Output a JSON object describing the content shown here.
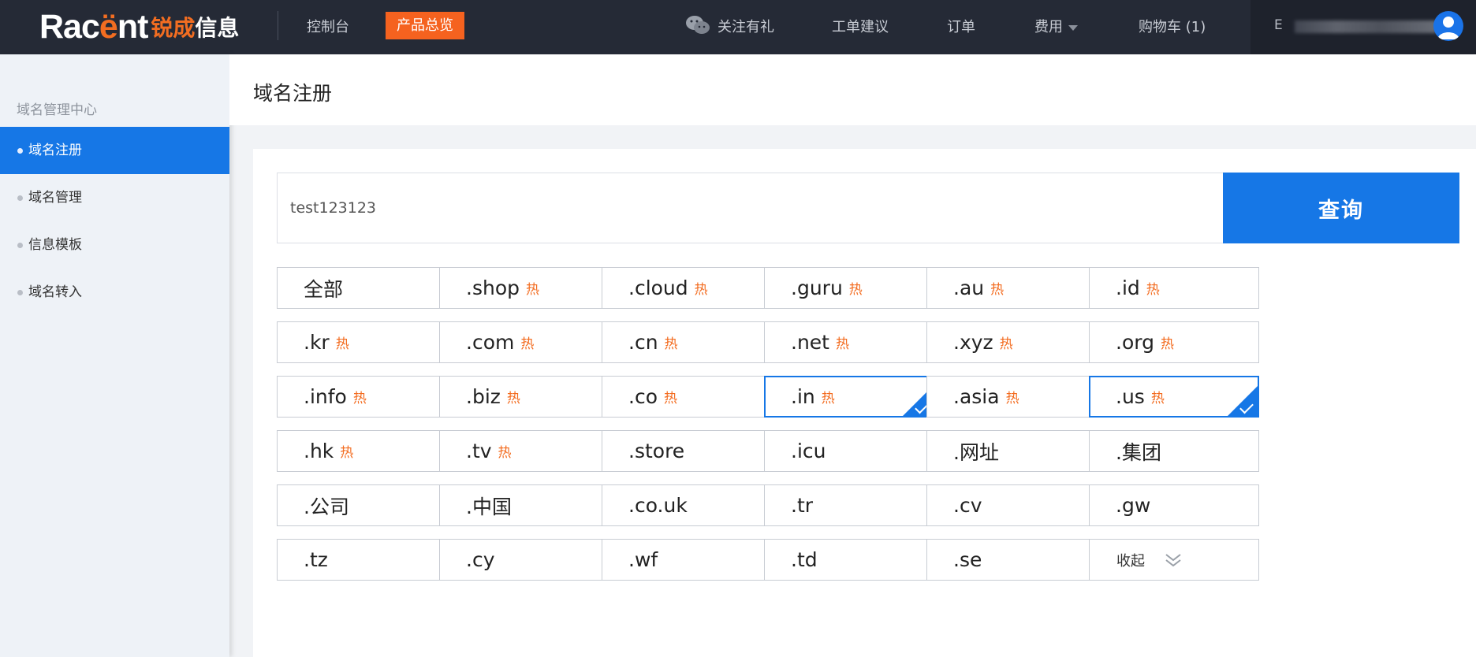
{
  "topbar": {
    "logo": {
      "main_a": "Rac",
      "main_accent": "ë",
      "main_b": "nt",
      "sub_a": "锐成",
      "sub_b": "信息"
    },
    "console_label": "控制台",
    "overview_label": "产品总览",
    "follow_label": "关注有礼",
    "ticket_label": "工单建议",
    "order_label": "订单",
    "fee_label": "费用",
    "cart_label": "购物车 (1)",
    "account_prefix": "E"
  },
  "sidebar": {
    "title": "域名管理中心",
    "items": [
      {
        "label": "域名注册",
        "active": true
      },
      {
        "label": "域名管理",
        "active": false
      },
      {
        "label": "信息模板",
        "active": false
      },
      {
        "label": "域名转入",
        "active": false
      }
    ]
  },
  "page": {
    "title": "域名注册"
  },
  "search": {
    "value": "test123123",
    "button_label": "查询"
  },
  "tld_hot_label": "热",
  "tlds": [
    {
      "name": "全部",
      "hot": false,
      "selected": false
    },
    {
      "name": ".shop",
      "hot": true,
      "selected": false
    },
    {
      "name": ".cloud",
      "hot": true,
      "selected": false
    },
    {
      "name": ".guru",
      "hot": true,
      "selected": false
    },
    {
      "name": ".au",
      "hot": true,
      "selected": false
    },
    {
      "name": ".id",
      "hot": true,
      "selected": false
    },
    {
      "name": ".kr",
      "hot": true,
      "selected": false
    },
    {
      "name": ".com",
      "hot": true,
      "selected": false
    },
    {
      "name": ".cn",
      "hot": true,
      "selected": false
    },
    {
      "name": ".net",
      "hot": true,
      "selected": false
    },
    {
      "name": ".xyz",
      "hot": true,
      "selected": false
    },
    {
      "name": ".org",
      "hot": true,
      "selected": false
    },
    {
      "name": ".info",
      "hot": true,
      "selected": false
    },
    {
      "name": ".biz",
      "hot": true,
      "selected": false
    },
    {
      "name": ".co",
      "hot": true,
      "selected": false
    },
    {
      "name": ".in",
      "hot": true,
      "selected": true
    },
    {
      "name": ".asia",
      "hot": true,
      "selected": false
    },
    {
      "name": ".us",
      "hot": true,
      "selected": true
    },
    {
      "name": ".hk",
      "hot": true,
      "selected": false
    },
    {
      "name": ".tv",
      "hot": true,
      "selected": false
    },
    {
      "name": ".store",
      "hot": false,
      "selected": false
    },
    {
      "name": ".icu",
      "hot": false,
      "selected": false
    },
    {
      "name": ".网址",
      "hot": false,
      "selected": false
    },
    {
      "name": ".集团",
      "hot": false,
      "selected": false
    },
    {
      "name": ".公司",
      "hot": false,
      "selected": false
    },
    {
      "name": ".中国",
      "hot": false,
      "selected": false
    },
    {
      "name": ".co.uk",
      "hot": false,
      "selected": false
    },
    {
      "name": ".tr",
      "hot": false,
      "selected": false
    },
    {
      "name": ".cv",
      "hot": false,
      "selected": false
    },
    {
      "name": ".gw",
      "hot": false,
      "selected": false
    },
    {
      "name": ".tz",
      "hot": false,
      "selected": false
    },
    {
      "name": ".cy",
      "hot": false,
      "selected": false
    },
    {
      "name": ".wf",
      "hot": false,
      "selected": false
    },
    {
      "name": ".td",
      "hot": false,
      "selected": false
    },
    {
      "name": ".se",
      "hot": false,
      "selected": false
    }
  ],
  "collapse_label": "收起",
  "colors": {
    "primary": "#1677e6",
    "accent": "#f5621f",
    "topbar": "#252a36"
  }
}
